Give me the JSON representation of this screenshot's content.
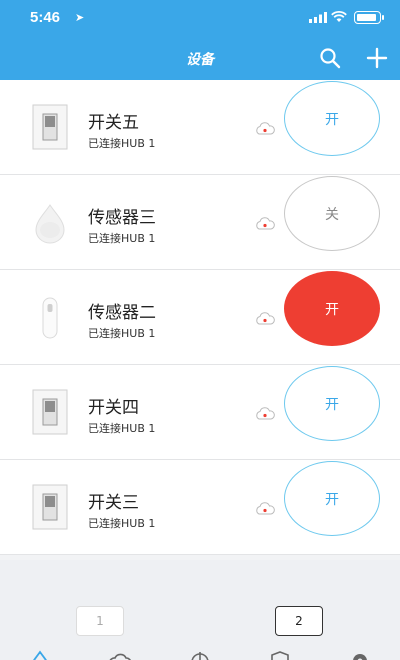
{
  "status_bar": {
    "time": "5:46",
    "location_arrow": "➤"
  },
  "navbar": {
    "title": "设备",
    "icons": [
      "search-icon",
      "plus-icon"
    ]
  },
  "colors": {
    "accent": "#3aa7e8",
    "toggle_border": "#6ec9ee",
    "active_red": "#ee3e32"
  },
  "devices": [
    {
      "name": "开关五",
      "status": "已连接HUB 1",
      "icon": "wall-switch-icon",
      "toggle": "开",
      "state": "on"
    },
    {
      "name": "传感器三",
      "status": "已连接HUB 1",
      "icon": "drop-sensor-icon",
      "toggle": "关",
      "state": "off"
    },
    {
      "name": "传感器二",
      "status": "已连接HUB 1",
      "icon": "door-sensor-icon",
      "toggle": "开",
      "state": "active"
    },
    {
      "name": "开关四",
      "status": "已连接HUB 1",
      "icon": "wall-switch-icon",
      "toggle": "开",
      "state": "on"
    },
    {
      "name": "开关三",
      "status": "已连接HUB 1",
      "icon": "wall-switch-icon",
      "toggle": "开",
      "state": "on"
    }
  ],
  "pagination": {
    "page1": "1",
    "page2": "2",
    "current": "2"
  },
  "tabbar": {
    "icons": [
      "device-tab-icon",
      "cloud-tab-icon",
      "power-tab-icon",
      "shield-tab-icon",
      "settings-tab-icon"
    ]
  }
}
